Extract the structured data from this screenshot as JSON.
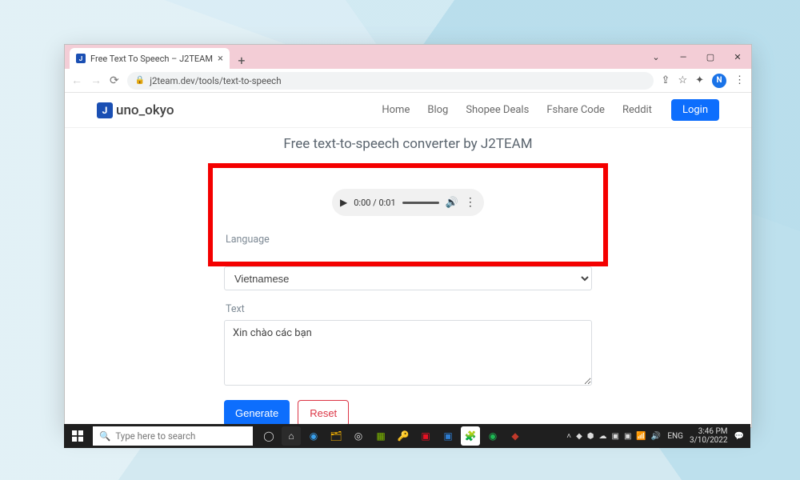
{
  "browser": {
    "tab_title": "Free Text To Speech – J2TEAM",
    "url": "j2team.dev/tools/text-to-speech",
    "profile_letter": "N"
  },
  "site": {
    "logo_mark": "J",
    "logo_text": "uno_okyo",
    "nav": {
      "home": "Home",
      "blog": "Blog",
      "shopee": "Shopee Deals",
      "fshare": "Fshare Code",
      "reddit": "Reddit"
    },
    "login": "Login"
  },
  "page": {
    "title": "Free text-to-speech converter by J2TEAM",
    "audio": {
      "time": "0:00 / 0:01"
    },
    "labels": {
      "language": "Language",
      "text": "Text"
    },
    "language_value": "Vietnamese",
    "text_value": "Xin chào các bạn",
    "buttons": {
      "generate": "Generate",
      "reset": "Reset"
    }
  },
  "taskbar": {
    "search_placeholder": "Type here to search",
    "lang": "ENG",
    "time": "3:46 PM",
    "date": "3/10/2022"
  }
}
